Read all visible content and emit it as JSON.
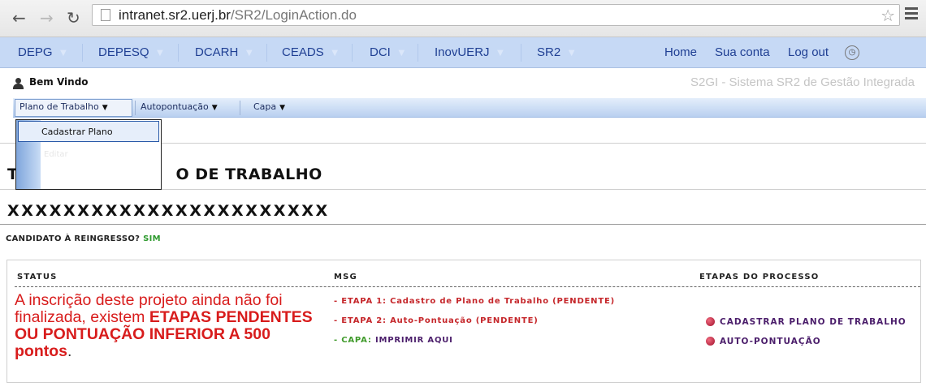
{
  "browser": {
    "url_host": "intranet.sr2.uerj.br",
    "url_path": "/SR2/LoginAction.do"
  },
  "topnav": {
    "items": [
      "DEPG",
      "DEPESQ",
      "DCARH",
      "CEADS",
      "DCI",
      "InovUERJ",
      "SR2"
    ],
    "right": [
      "Home",
      "Sua conta",
      "Log out"
    ]
  },
  "welcome": {
    "greeting": "Bem Vindo",
    "system_name": "S2GI - Sistema SR2 de Gestão Integrada"
  },
  "submenu": {
    "items": [
      "Plano de Trabalho",
      "Autopontuação",
      "Capa"
    ]
  },
  "dropdown": {
    "options": [
      "Cadastrar Plano",
      "Editar"
    ]
  },
  "page": {
    "title_start": "T",
    "title_end": "O DE TRABALHO",
    "name": "XXXXXXXXXXXXXXXXXXXXXXX",
    "candidate_label": "CANDIDATO À REINGRESSO?",
    "candidate_value": "SIM"
  },
  "status": {
    "headers": {
      "status": "STATUS",
      "msg": "MSG",
      "etapas": "ETAPAS DO PROCESSO"
    },
    "message_part1": "A inscrição deste projeto ainda não foi finalizada, existem ",
    "message_bold": "ETAPAS PENDENTES OU PONTUAÇÃO INFERIOR A 500 pontos",
    "message_end": ".",
    "msgs": [
      "- ETAPA 1: Cadastro de Plano de Trabalho (PENDENTE)",
      "- ETAPA 2: Auto-Pontuação (PENDENTE)"
    ],
    "capa_label": "- CAPA: ",
    "capa_link": "IMPRIMIR AQUI",
    "etapas": [
      "CADASTRAR PLANO DE TRABALHO",
      "AUTO-PONTUAÇÃO"
    ]
  },
  "colors": {
    "nav_bg": "#c6d9f5",
    "nav_text": "#1f3f93",
    "alert_red": "#d81c1c",
    "link_purple": "#4b1e6b",
    "sim_green": "#2e9a2e"
  }
}
